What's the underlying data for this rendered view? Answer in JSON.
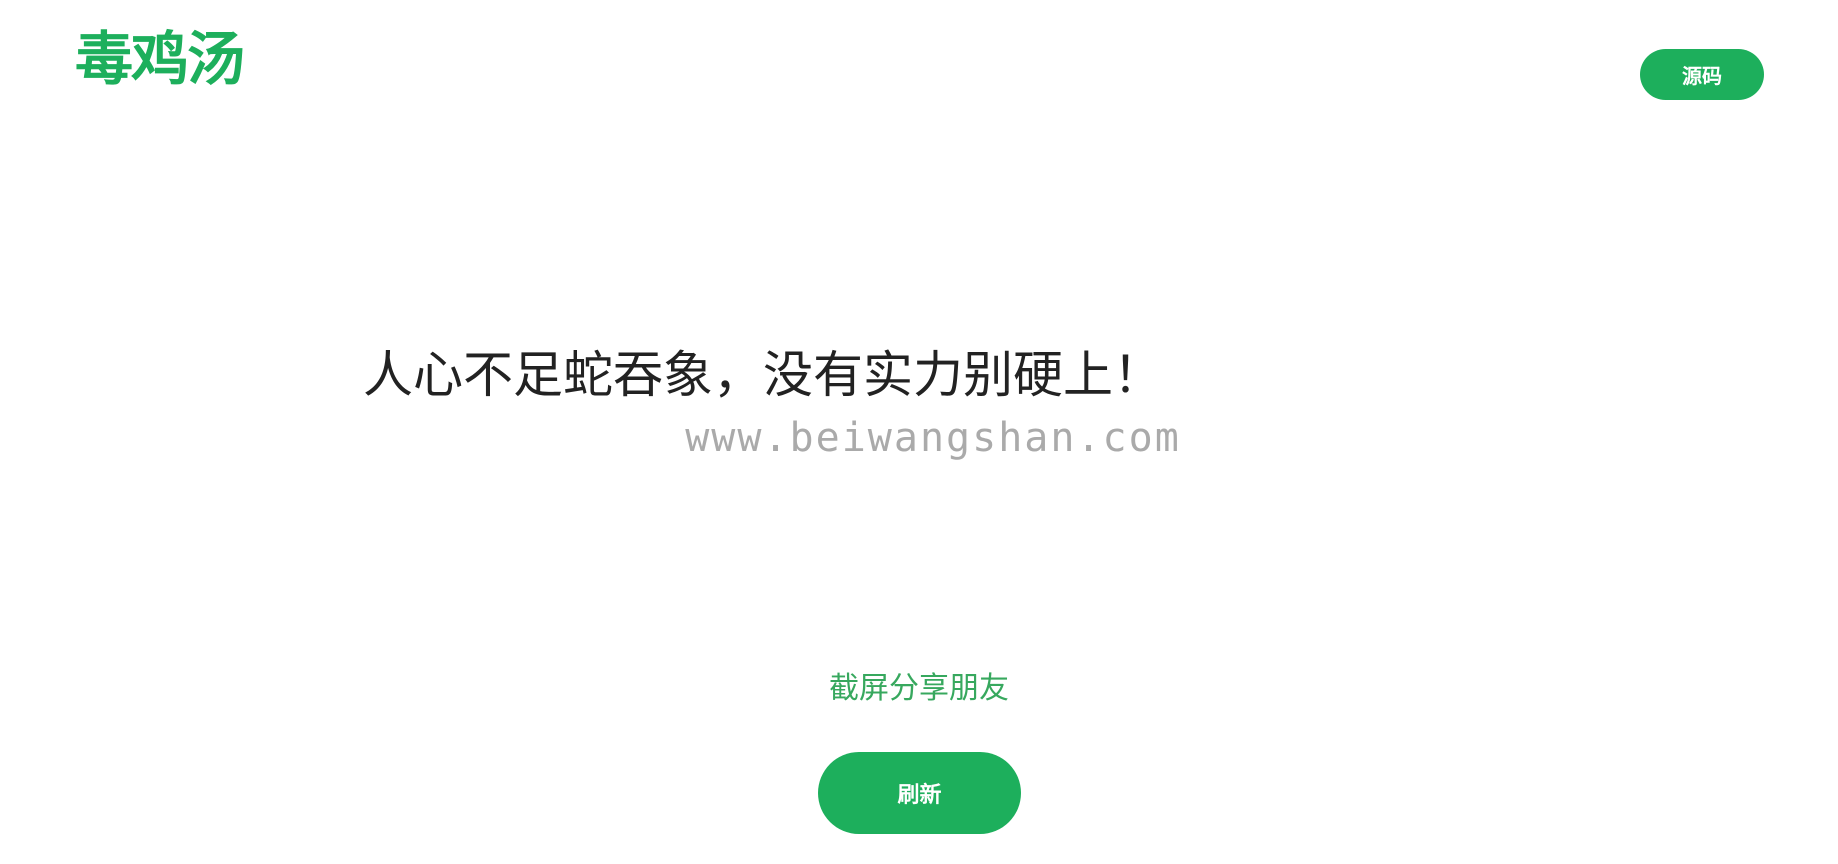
{
  "header": {
    "logo_text": "毒鸡汤",
    "source_button_label": "源码"
  },
  "main": {
    "quote": "人心不足蛇吞象，没有实力别硬上！",
    "watermark": "www.beiwangshan.com",
    "share_hint": "截屏分享朋友",
    "refresh_button_label": "刷新"
  },
  "colors": {
    "brand_green": "#1daf5c",
    "hint_green": "#37a85e",
    "quote_text": "#222222",
    "watermark_gray": "#aaaaaa"
  }
}
